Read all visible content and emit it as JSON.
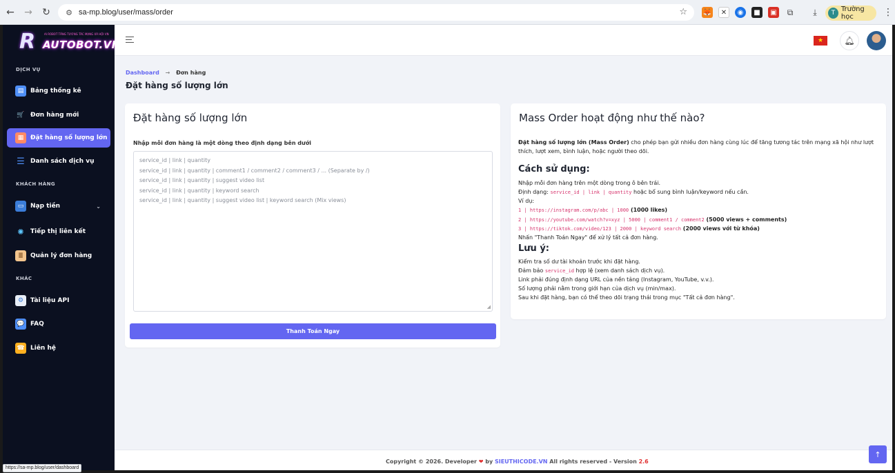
{
  "browser": {
    "url": "sa-mp.blog/user/mass/order",
    "profile_initial": "T",
    "profile_name": "Trường học",
    "status_url": "https://sa-mp.blog/user/dashboard"
  },
  "logo": {
    "text": "AUTOBOT.VN",
    "tagline": "AI ROBOT TĂNG TƯƠNG TÁC MẠNG XÃ HỘI VN"
  },
  "sidebar": {
    "sections": [
      {
        "label": "DỊCH VỤ"
      },
      {
        "label": "KHÁCH HÀNG"
      },
      {
        "label": "KHÁC"
      }
    ],
    "items": [
      {
        "label": "Bảng thống kê",
        "icon": "dashboard-icon"
      },
      {
        "label": "Đơn hàng mới",
        "icon": "cart-icon"
      },
      {
        "label": "Đặt hàng số lượng lớn",
        "icon": "mass-order-icon",
        "active": true
      },
      {
        "label": "Danh sách dịch vụ",
        "icon": "list-icon"
      },
      {
        "label": "Nạp tiền",
        "icon": "wallet-icon"
      },
      {
        "label": "Tiếp thị liên kết",
        "icon": "network-icon"
      },
      {
        "label": "Quản lý đơn hàng",
        "icon": "clipboard-icon"
      },
      {
        "label": "Tài liệu API",
        "icon": "api-doc-icon"
      },
      {
        "label": "FAQ",
        "icon": "chat-icon"
      },
      {
        "label": "Liên hệ",
        "icon": "support-icon"
      }
    ]
  },
  "breadcrumb": {
    "home": "Dashboard",
    "current": "Đơn hàng"
  },
  "page_title": "Đặt hàng số lượng lớn",
  "order_card": {
    "title": "Đặt hàng số lượng lớn",
    "instruction": "Nhập mỗi đơn hàng là một dòng theo định dạng bên dưới",
    "placeholder_lines": [
      "service_id | link | quantity",
      "service_id | link | quantity | comment1 / comment2 / comment3 / ... (Separate by /)",
      "service_id | link | quantity | suggest video list",
      "service_id | link | quantity | keyword search",
      "service_id | link | quantity | suggest video list | keyword search (Mix views)"
    ],
    "submit_label": "Thanh Toán Ngay"
  },
  "help_card": {
    "title": "Mass Order hoạt động như thế nào?",
    "intro_bold": "Đặt hàng số lượng lớn (Mass Order)",
    "intro_rest": " cho phép bạn gửi nhiều đơn hàng cùng lúc để tăng tương tác trên mạng xã hội như lượt",
    "intro_line2": "thích, lượt xem, bình luận, hoặc người theo dõi.",
    "usage_heading": "Cách sử dụng:",
    "usage_line1": "Nhập mỗi đơn hàng trên một dòng trong ô bên trái.",
    "format_label": "Định dạng:",
    "format_code": "service_id | link | quantity",
    "format_rest": " hoặc bổ sung bình luận/keyword nếu cần.",
    "example_label": "Ví dụ:",
    "examples": [
      {
        "code": "1 | https://instagram.com/p/abc | 1000",
        "note": " (1000 likes)"
      },
      {
        "code": "2 | https://youtube.com/watch?v=xyz | 5000 | comment1 / comment2",
        "note": " (5000 views + comments)"
      },
      {
        "code": "3 | https://tiktok.com/video/123 | 2000 | keyword search",
        "note": " (2000 views với từ khóa)"
      }
    ],
    "press_line": "Nhấn \"Thanh Toán Ngay\" để xử lý tất cả đơn hàng.",
    "notes_heading": "Lưu ý:",
    "note1": "Kiểm tra số dư tài khoản trước khi đặt hàng.",
    "note2_pre": "Đảm bảo ",
    "note2_code": "service_id",
    "note2_post": " hợp lệ (xem danh sách dịch vụ).",
    "note3": "Link phải đúng định dạng URL của nền tảng (Instagram, YouTube, v.v.).",
    "note4": "Số lượng phải nằm trong giới hạn của dịch vụ (min/max).",
    "note5": "Sau khi đặt hàng, bạn có thể theo dõi trạng thái trong mục \"Tất cả đơn hàng\"."
  },
  "footer": {
    "prefix": "Copyright © 2026. Developer ",
    "by": " by ",
    "brand": "SIEUTHICODE.VN",
    "rights": " All rights reserved - Version ",
    "version": "2.6"
  },
  "colors": {
    "accent": "#6366f1",
    "sidebar_bg": "#0b1020",
    "page_bg": "#f1f3f8",
    "code": "#d6336c"
  }
}
